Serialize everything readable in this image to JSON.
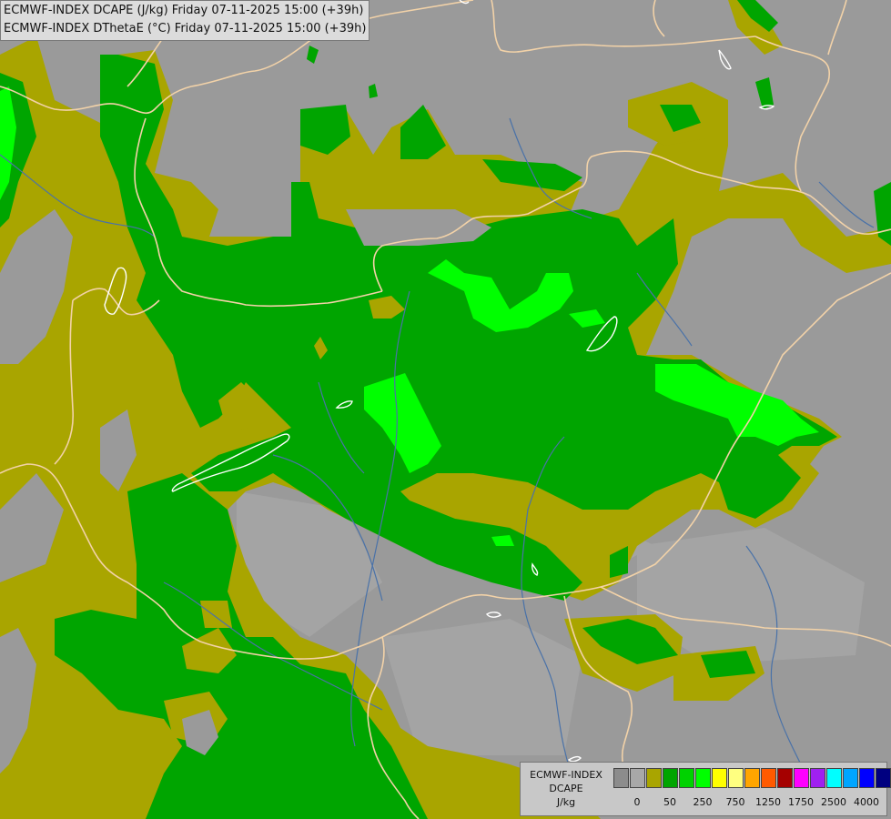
{
  "header": {
    "line1": "ECMWF-INDEX DCAPE (J/kg) Friday 07-11-2025 15:00 (+39h)",
    "line2": "ECMWF-INDEX DThetaE (°C) Friday 07-11-2025 15:00 (+39h)"
  },
  "legend": {
    "model": "ECMWF-INDEX",
    "parameter": "DCAPE",
    "unit": "J/kg",
    "colors": [
      "#8c8c8c",
      "#a8a8a8",
      "#a9a500",
      "#00a500",
      "#00d200",
      "#00ff00",
      "#ffff00",
      "#ffff80",
      "#ffa500",
      "#ff5a00",
      "#a50000",
      "#ff00ff",
      "#a020f0",
      "#00ffff",
      "#00a5ff",
      "#0000ff",
      "#000080"
    ],
    "tick_labels": [
      "0",
      "50",
      "250",
      "750",
      "1250",
      "1750",
      "2500",
      "4000"
    ],
    "tick_at_swatch": [
      1,
      3,
      5,
      7,
      9,
      11,
      13,
      15
    ]
  },
  "colors": {
    "background": "#9a9a9a",
    "olive": "#a9a500",
    "green": "#00a500",
    "bright_green": "#00ff00",
    "borders": "#f2d2a8",
    "rivers": "#4a72a8",
    "lakes": "#ffffff"
  }
}
